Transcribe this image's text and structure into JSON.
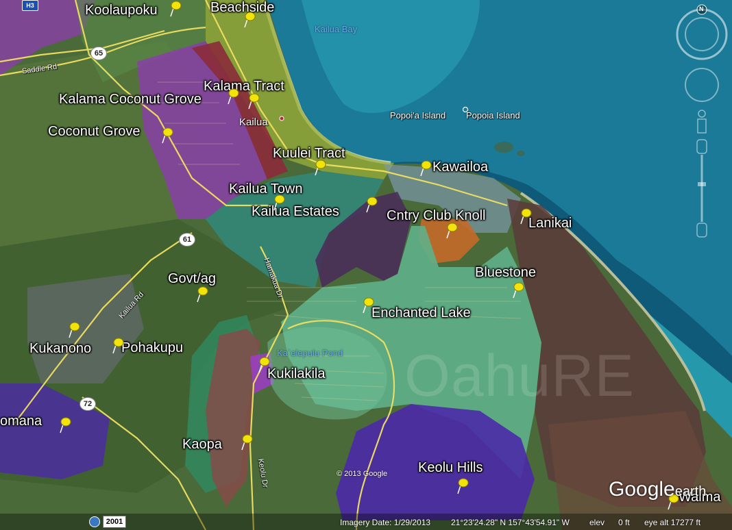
{
  "neighborhoods": [
    {
      "name": "Koolaupoku"
    },
    {
      "name": "Beachside"
    },
    {
      "name": "Kalama Tract"
    },
    {
      "name": "Kalama Coconut Grove"
    },
    {
      "name": "Coconut Grove"
    },
    {
      "name": "Kuulei Tract"
    },
    {
      "name": "Kawailoa"
    },
    {
      "name": "Kailua Town"
    },
    {
      "name": "Kailua Estates"
    },
    {
      "name": "Cntry Club Knoll"
    },
    {
      "name": "Lanikai"
    },
    {
      "name": "Govt/ag"
    },
    {
      "name": "Bluestone"
    },
    {
      "name": "Enchanted Lake"
    },
    {
      "name": "Kukanono"
    },
    {
      "name": "Pohakupu"
    },
    {
      "name": "Kukilakila"
    },
    {
      "name": "omana"
    },
    {
      "name": "Kaopa"
    },
    {
      "name": "Keolu Hills"
    },
    {
      "name": "Waima"
    }
  ],
  "water_labels": {
    "kailua_bay": "Kailua Bay",
    "popoia_island_1": "Popoi'a Island",
    "popoia_island_2": "Popoia Island",
    "pond": "Ka`elepulu Pond"
  },
  "place_labels": {
    "kailua": "Kailua"
  },
  "roads": {
    "saddle_rd": "Saddle Rd",
    "kailua_rd": "Kailua Rd",
    "hamakua_dr": "Hamakua Dr",
    "keolu_dr": "Keolu Dr",
    "route_65": "65",
    "route_61": "61",
    "route_72": "72",
    "h3": "H3"
  },
  "watermark": "OahuRE",
  "attribution": {
    "copyright": "© 2013 Google",
    "logo_main": "Google",
    "logo_sub": "earth"
  },
  "status_bar": {
    "year": "2001",
    "imagery_date": "Imagery Date: 1/29/2013",
    "coords": "21°23'24.28\" N  157°43'54.91\" W",
    "elev_label": "elev",
    "elev_value": "0 ft",
    "eye_alt": "eye alt  17277 ft"
  },
  "navigation": {
    "north_label": "N"
  },
  "colors": {
    "pin": "#f2e30a",
    "purple_zone": "#8a3fa8",
    "maroon_zone": "#8b2b3a",
    "teal_zone": "#2f8a80",
    "green_zone": "#5fb08a",
    "dark_purple_zone": "#4a2f5a",
    "violet_zone": "#4b2aa8",
    "orange_zone": "#c46a2a",
    "road": "#f0e060"
  }
}
